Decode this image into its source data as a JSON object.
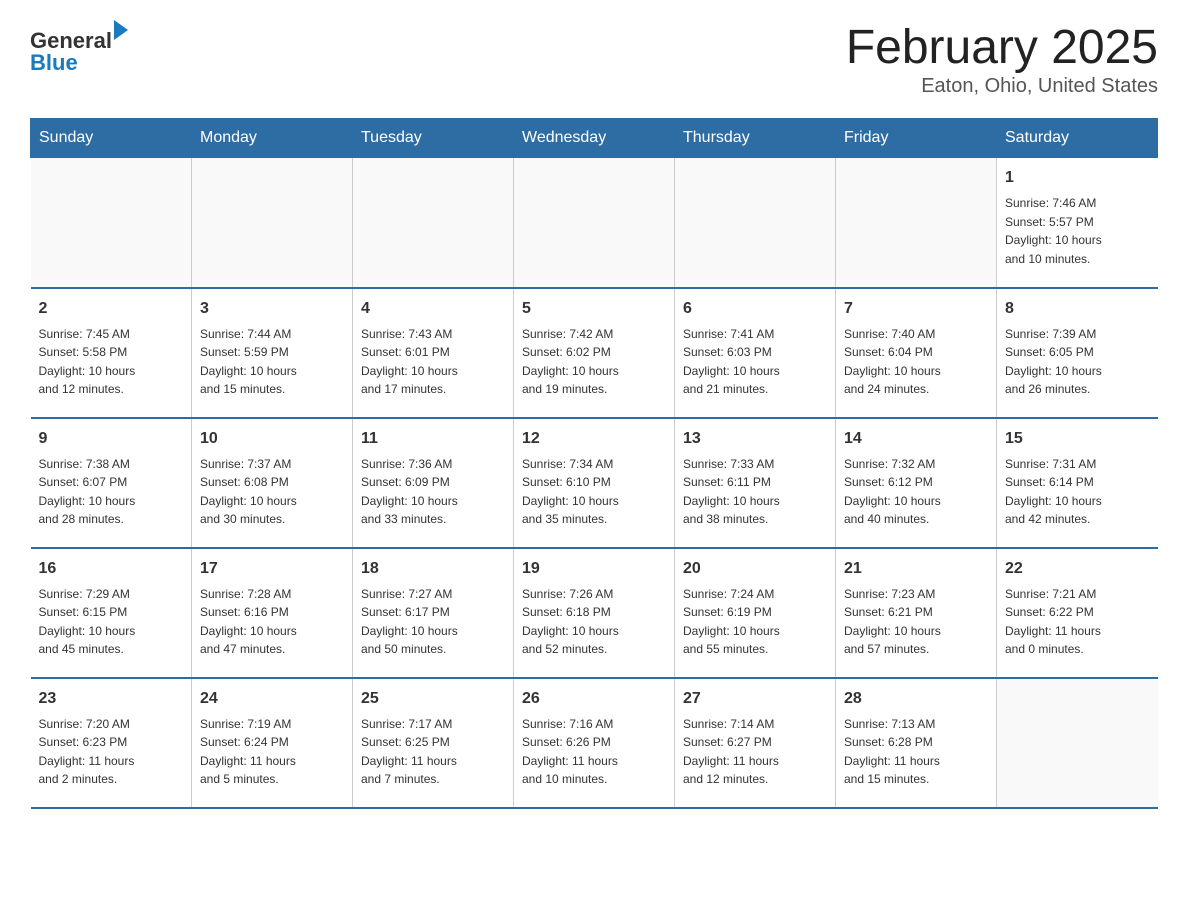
{
  "header": {
    "logo_general": "General",
    "logo_blue": "Blue",
    "month_title": "February 2025",
    "location": "Eaton, Ohio, United States"
  },
  "days_of_week": [
    "Sunday",
    "Monday",
    "Tuesday",
    "Wednesday",
    "Thursday",
    "Friday",
    "Saturday"
  ],
  "weeks": [
    [
      {
        "day": "",
        "info": ""
      },
      {
        "day": "",
        "info": ""
      },
      {
        "day": "",
        "info": ""
      },
      {
        "day": "",
        "info": ""
      },
      {
        "day": "",
        "info": ""
      },
      {
        "day": "",
        "info": ""
      },
      {
        "day": "1",
        "info": "Sunrise: 7:46 AM\nSunset: 5:57 PM\nDaylight: 10 hours\nand 10 minutes."
      }
    ],
    [
      {
        "day": "2",
        "info": "Sunrise: 7:45 AM\nSunset: 5:58 PM\nDaylight: 10 hours\nand 12 minutes."
      },
      {
        "day": "3",
        "info": "Sunrise: 7:44 AM\nSunset: 5:59 PM\nDaylight: 10 hours\nand 15 minutes."
      },
      {
        "day": "4",
        "info": "Sunrise: 7:43 AM\nSunset: 6:01 PM\nDaylight: 10 hours\nand 17 minutes."
      },
      {
        "day": "5",
        "info": "Sunrise: 7:42 AM\nSunset: 6:02 PM\nDaylight: 10 hours\nand 19 minutes."
      },
      {
        "day": "6",
        "info": "Sunrise: 7:41 AM\nSunset: 6:03 PM\nDaylight: 10 hours\nand 21 minutes."
      },
      {
        "day": "7",
        "info": "Sunrise: 7:40 AM\nSunset: 6:04 PM\nDaylight: 10 hours\nand 24 minutes."
      },
      {
        "day": "8",
        "info": "Sunrise: 7:39 AM\nSunset: 6:05 PM\nDaylight: 10 hours\nand 26 minutes."
      }
    ],
    [
      {
        "day": "9",
        "info": "Sunrise: 7:38 AM\nSunset: 6:07 PM\nDaylight: 10 hours\nand 28 minutes."
      },
      {
        "day": "10",
        "info": "Sunrise: 7:37 AM\nSunset: 6:08 PM\nDaylight: 10 hours\nand 30 minutes."
      },
      {
        "day": "11",
        "info": "Sunrise: 7:36 AM\nSunset: 6:09 PM\nDaylight: 10 hours\nand 33 minutes."
      },
      {
        "day": "12",
        "info": "Sunrise: 7:34 AM\nSunset: 6:10 PM\nDaylight: 10 hours\nand 35 minutes."
      },
      {
        "day": "13",
        "info": "Sunrise: 7:33 AM\nSunset: 6:11 PM\nDaylight: 10 hours\nand 38 minutes."
      },
      {
        "day": "14",
        "info": "Sunrise: 7:32 AM\nSunset: 6:12 PM\nDaylight: 10 hours\nand 40 minutes."
      },
      {
        "day": "15",
        "info": "Sunrise: 7:31 AM\nSunset: 6:14 PM\nDaylight: 10 hours\nand 42 minutes."
      }
    ],
    [
      {
        "day": "16",
        "info": "Sunrise: 7:29 AM\nSunset: 6:15 PM\nDaylight: 10 hours\nand 45 minutes."
      },
      {
        "day": "17",
        "info": "Sunrise: 7:28 AM\nSunset: 6:16 PM\nDaylight: 10 hours\nand 47 minutes."
      },
      {
        "day": "18",
        "info": "Sunrise: 7:27 AM\nSunset: 6:17 PM\nDaylight: 10 hours\nand 50 minutes."
      },
      {
        "day": "19",
        "info": "Sunrise: 7:26 AM\nSunset: 6:18 PM\nDaylight: 10 hours\nand 52 minutes."
      },
      {
        "day": "20",
        "info": "Sunrise: 7:24 AM\nSunset: 6:19 PM\nDaylight: 10 hours\nand 55 minutes."
      },
      {
        "day": "21",
        "info": "Sunrise: 7:23 AM\nSunset: 6:21 PM\nDaylight: 10 hours\nand 57 minutes."
      },
      {
        "day": "22",
        "info": "Sunrise: 7:21 AM\nSunset: 6:22 PM\nDaylight: 11 hours\nand 0 minutes."
      }
    ],
    [
      {
        "day": "23",
        "info": "Sunrise: 7:20 AM\nSunset: 6:23 PM\nDaylight: 11 hours\nand 2 minutes."
      },
      {
        "day": "24",
        "info": "Sunrise: 7:19 AM\nSunset: 6:24 PM\nDaylight: 11 hours\nand 5 minutes."
      },
      {
        "day": "25",
        "info": "Sunrise: 7:17 AM\nSunset: 6:25 PM\nDaylight: 11 hours\nand 7 minutes."
      },
      {
        "day": "26",
        "info": "Sunrise: 7:16 AM\nSunset: 6:26 PM\nDaylight: 11 hours\nand 10 minutes."
      },
      {
        "day": "27",
        "info": "Sunrise: 7:14 AM\nSunset: 6:27 PM\nDaylight: 11 hours\nand 12 minutes."
      },
      {
        "day": "28",
        "info": "Sunrise: 7:13 AM\nSunset: 6:28 PM\nDaylight: 11 hours\nand 15 minutes."
      },
      {
        "day": "",
        "info": ""
      }
    ]
  ]
}
